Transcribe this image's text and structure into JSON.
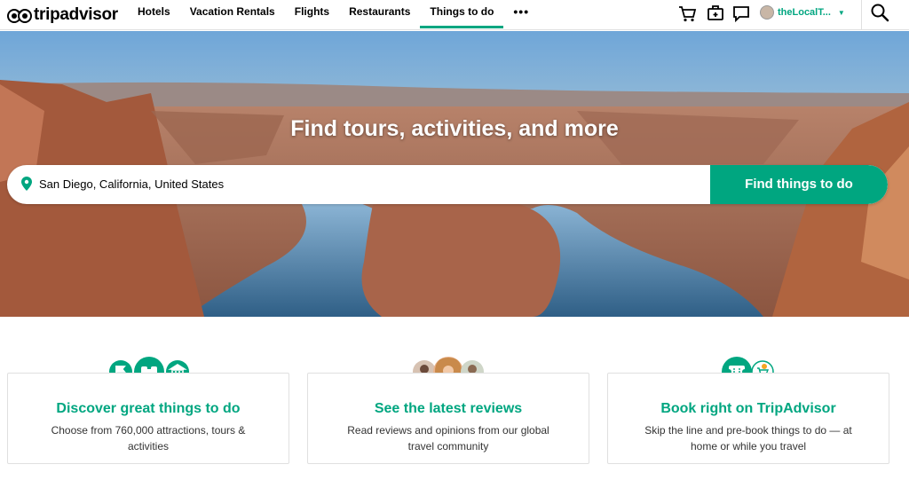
{
  "header": {
    "logo_text": "tripadvisor",
    "nav": [
      {
        "label": "Hotels"
      },
      {
        "label": "Vacation Rentals"
      },
      {
        "label": "Flights"
      },
      {
        "label": "Restaurants"
      },
      {
        "label": "Things to do",
        "active": true
      }
    ],
    "more_label": "•••",
    "username": "theLocalT...",
    "icons": [
      "cart-icon",
      "trips-icon",
      "messages-icon",
      "search-icon"
    ]
  },
  "hero": {
    "title": "Find tours, activities, and more",
    "search_value": "San Diego, California, United States",
    "search_button": "Find things to do"
  },
  "features": [
    {
      "title": "Discover great things to do",
      "desc": "Choose from 760,000 attractions, tours & activities"
    },
    {
      "title": "See the latest reviews",
      "desc": "Read reviews and opinions from our global travel community"
    },
    {
      "title": "Book right on TripAdvisor",
      "desc": "Skip the line and pre-book things to do — at home or while you travel"
    }
  ],
  "colors": {
    "accent": "#00a680"
  }
}
